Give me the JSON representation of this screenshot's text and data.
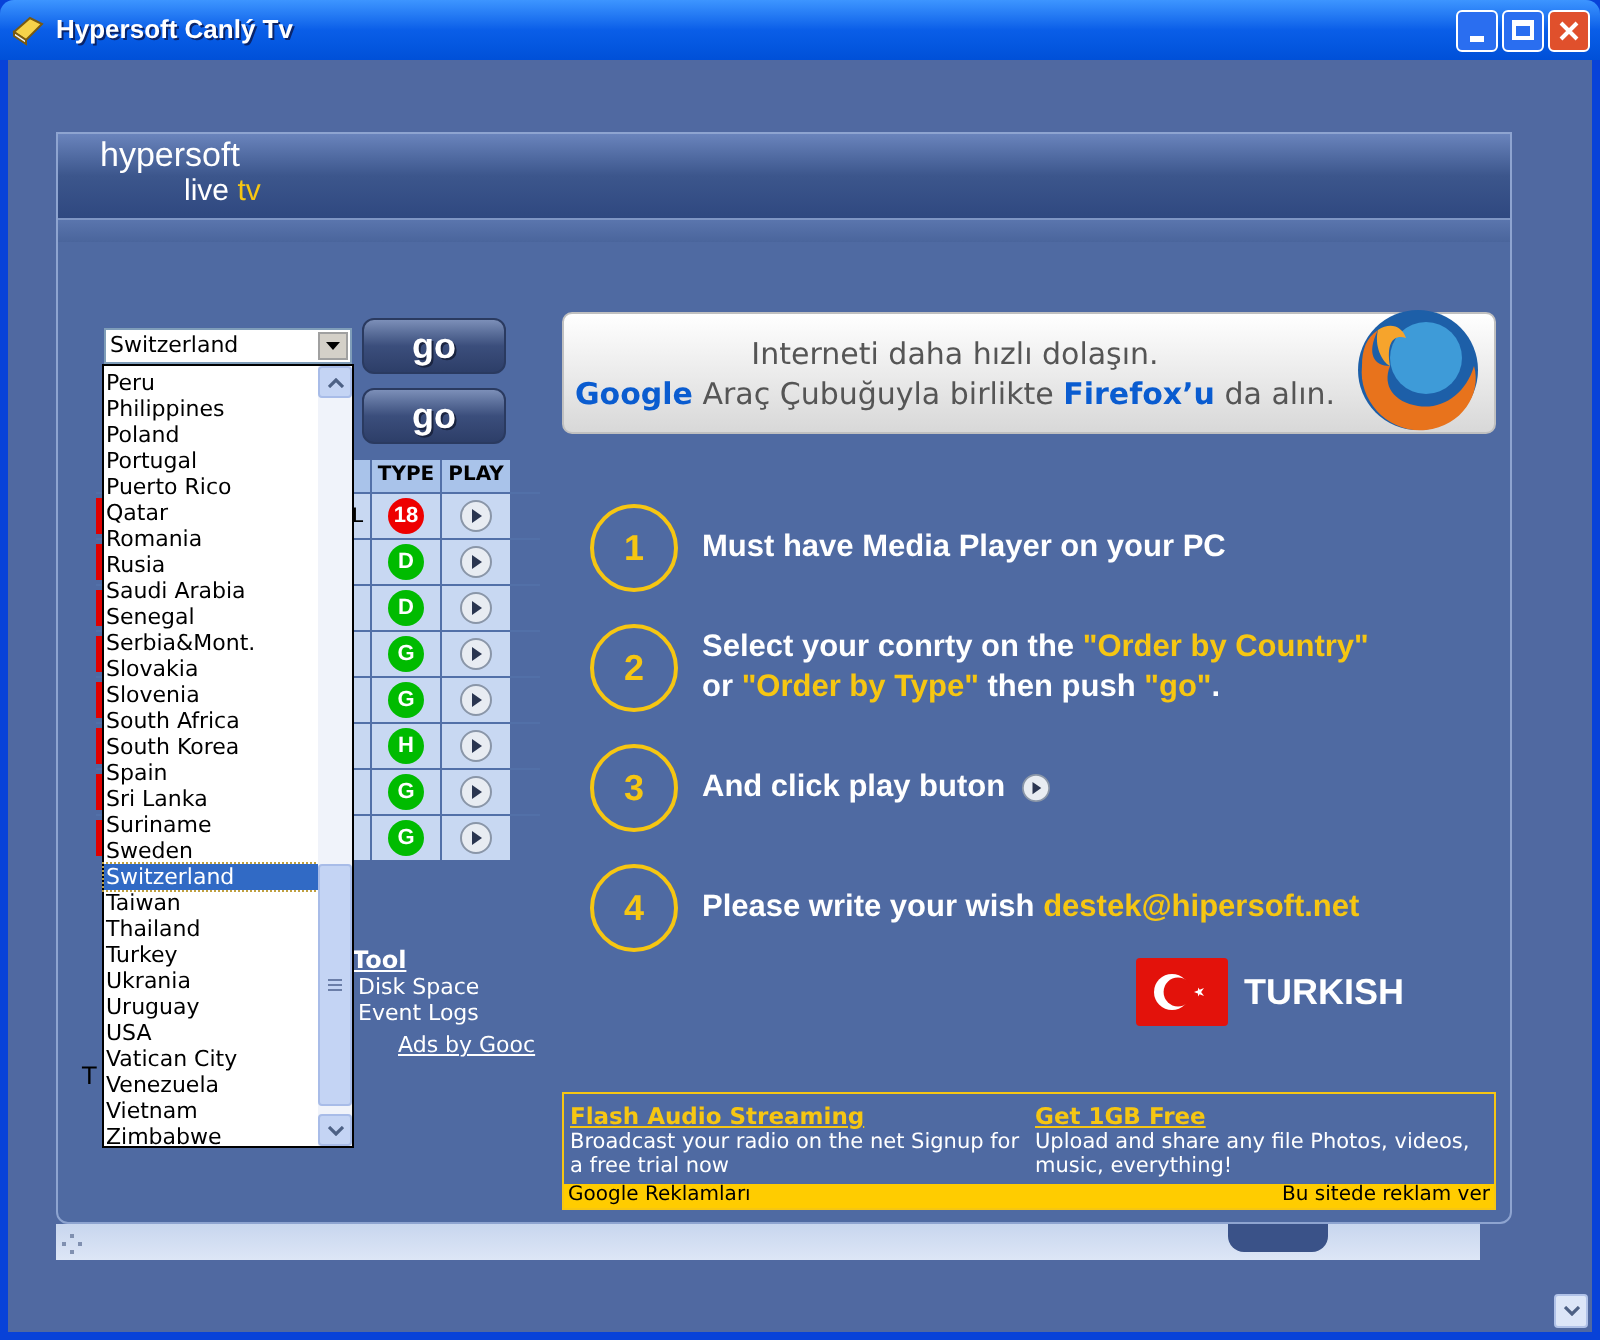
{
  "window": {
    "title": "Hypersoft Canlý Tv"
  },
  "logo": {
    "line_1": "hypersoft",
    "line_2": [
      {
        "text": "live ",
        "accent": false
      },
      {
        "text": "tv",
        "accent": true
      }
    ]
  },
  "country_select": {
    "value": "Switzerland",
    "expanded": true,
    "options": [
      {
        "label": "Peru",
        "selected": false
      },
      {
        "label": "Philippines",
        "selected": false
      },
      {
        "label": "Poland",
        "selected": false
      },
      {
        "label": "Portugal",
        "selected": false
      },
      {
        "label": "Puerto Rico",
        "selected": false
      },
      {
        "label": "Qatar",
        "selected": false
      },
      {
        "label": "Romania",
        "selected": false
      },
      {
        "label": "Rusia",
        "selected": false
      },
      {
        "label": "Saudi Arabia",
        "selected": false
      },
      {
        "label": "Senegal",
        "selected": false
      },
      {
        "label": "Serbia&Mont.",
        "selected": false
      },
      {
        "label": "Slovakia",
        "selected": false
      },
      {
        "label": "Slovenia",
        "selected": false
      },
      {
        "label": "South Africa",
        "selected": false
      },
      {
        "label": "South Korea",
        "selected": false
      },
      {
        "label": "Spain",
        "selected": false
      },
      {
        "label": "Sri Lanka",
        "selected": false
      },
      {
        "label": "Suriname",
        "selected": false
      },
      {
        "label": "Sweden",
        "selected": false
      },
      {
        "label": "Switzerland",
        "selected": true
      },
      {
        "label": "Taiwan",
        "selected": false
      },
      {
        "label": "Thailand",
        "selected": false
      },
      {
        "label": "Turkey",
        "selected": false
      },
      {
        "label": "Ukrania",
        "selected": false
      },
      {
        "label": "Uruguay",
        "selected": false
      },
      {
        "label": "USA",
        "selected": false
      },
      {
        "label": "Vatican City",
        "selected": false
      },
      {
        "label": "Venezuela",
        "selected": false
      },
      {
        "label": "Vietnam",
        "selected": false
      },
      {
        "label": "Zimbabwe",
        "selected": false
      }
    ]
  },
  "go_buttons": [
    "go",
    "go"
  ],
  "table": {
    "columns": [
      "TYPE",
      "PLAY"
    ],
    "rows": [
      {
        "column_1": "L",
        "type": "18",
        "color": "#ee0000"
      },
      {
        "type": "D",
        "color": "#00bb00"
      },
      {
        "type": "D",
        "color": "#00bb00"
      },
      {
        "type": "G",
        "color": "#00bb00"
      },
      {
        "type": "G",
        "color": "#00bb00"
      },
      {
        "type": "H",
        "color": "#00bb00"
      },
      {
        "type": "G",
        "color": "#00bb00"
      },
      {
        "type": "G",
        "color": "#00bb00"
      }
    ]
  },
  "side_links": [
    {
      "text": "Tool",
      "kind": "heading"
    },
    {
      "text": "Disk Space",
      "kind": "item"
    },
    {
      "text": "Event Logs",
      "kind": "item"
    },
    {
      "text": "Ads by Gooc",
      "kind": "link"
    }
  ],
  "stray_text": "T",
  "banner": {
    "line_1": [
      {
        "text": "Interneti daha hızlı dolaşın.",
        "brand": false
      }
    ],
    "line_2": [
      {
        "text": "Google",
        "brand": true
      },
      {
        "text": " Araç Çubuğuyla birlikte ",
        "brand": false
      },
      {
        "text": "Firefox’u",
        "brand": true
      },
      {
        "text": " da alın.",
        "brand": false
      }
    ]
  },
  "steps": [
    {
      "number": "1",
      "play_icon": false,
      "lines": [
        [
          {
            "text": "Must have Media Player on your PC",
            "highlight": false
          }
        ]
      ]
    },
    {
      "number": "2",
      "play_icon": false,
      "lines": [
        [
          {
            "text": "Select your conrty on the  ",
            "highlight": false
          },
          {
            "text": "\"Order by Country\"",
            "highlight": true
          }
        ],
        [
          {
            "text": "or ",
            "highlight": false
          },
          {
            "text": "\"Order by Type\"",
            "highlight": true
          },
          {
            "text": "  then push ",
            "highlight": false
          },
          {
            "text": "\"go\"",
            "highlight": true
          },
          {
            "text": ".",
            "highlight": false
          }
        ]
      ]
    },
    {
      "number": "3",
      "play_icon": true,
      "lines": [
        [
          {
            "text": "And click play buton",
            "highlight": false
          }
        ]
      ]
    },
    {
      "number": "4",
      "play_icon": false,
      "lines": [
        [
          {
            "text": "Please write your wish  ",
            "highlight": false
          },
          {
            "text": "destek@hipersoft.net",
            "highlight": true
          }
        ]
      ]
    }
  ],
  "language_button": "TURKISH",
  "ads": {
    "items": [
      {
        "title": "Flash Audio Streaming",
        "text": "Broadcast your radio on the net Signup for a free trial now"
      },
      {
        "title": "Get 1GB Free",
        "text": "Upload and share any file Photos, videos, music, everything!"
      }
    ],
    "footer_left": "Google Reklamları",
    "footer_right": "Bu sitede reklam ver"
  }
}
